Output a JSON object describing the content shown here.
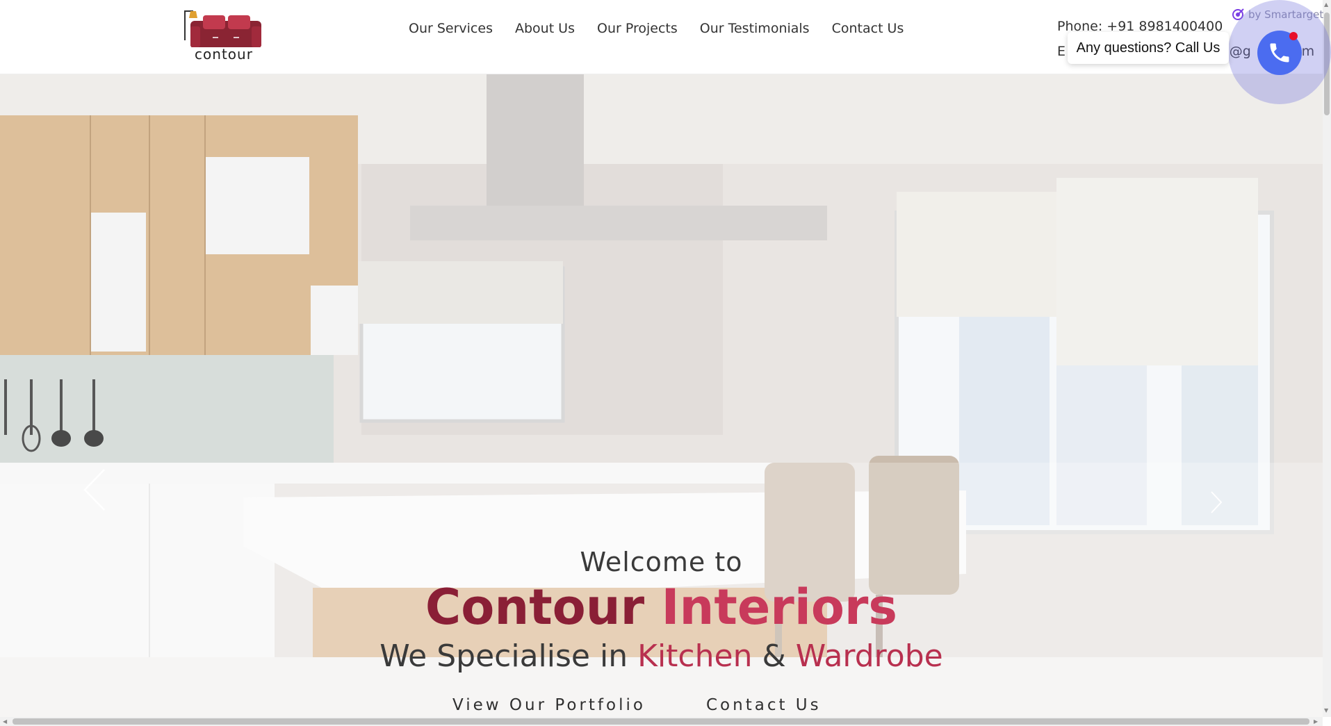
{
  "header": {
    "logo_text": "contour",
    "nav": [
      {
        "label": "Our Services"
      },
      {
        "label": "About Us"
      },
      {
        "label": "Our Projects"
      },
      {
        "label": "Our Testimonials"
      },
      {
        "label": "Contact Us"
      }
    ],
    "phone": "Phone: +91 8981400400",
    "email_prefix": "E",
    "email_suffix": "rs@g",
    "email_end": "om"
  },
  "widget": {
    "by_text": "by Smartarget",
    "tooltip": "Any questions? Call Us",
    "button_color": "#4b6cf0",
    "dot_color": "#e8102a"
  },
  "hero": {
    "welcome": "Welcome to",
    "brand_part1": "Contour",
    "brand_part2": "Interiors",
    "spec_prefix": "We Specialise in",
    "spec_kitchen": "Kitchen",
    "spec_and": "&",
    "spec_wardrobe": "Wardrobe",
    "cta_portfolio": "View Our Portfolio",
    "cta_contact": "Contact Us"
  },
  "colors": {
    "brand_dark": "#8a1f36",
    "brand_light": "#c83a5b"
  }
}
